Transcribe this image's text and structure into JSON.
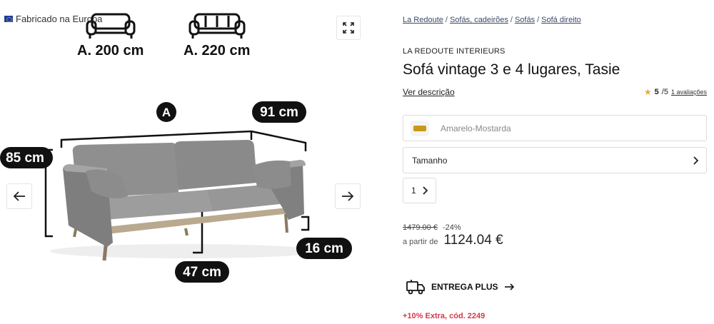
{
  "gallery": {
    "made_in": "Fabricado na Europa",
    "size_options": [
      {
        "label": "A. 200 cm"
      },
      {
        "label": "A. 220 cm"
      }
    ],
    "dimensions": {
      "marker": "A",
      "depth": "91 cm",
      "height": "85 cm",
      "seat_height": "47 cm",
      "leg_height": "16 cm"
    },
    "expand_icon": "expand-icon",
    "prev_icon": "arrow-left-icon",
    "next_icon": "arrow-right-icon"
  },
  "breadcrumb": [
    "La Redoute",
    "Sofás, cadeirões",
    "Sofás",
    "Sofá direito"
  ],
  "breadcrumb_separator": "/",
  "product": {
    "brand": "LA REDOUTE INTERIEURS",
    "title": "Sofá vintage 3 e 4 lugares, Tasie",
    "see_description": "Ver descrição",
    "rating": {
      "score": "5",
      "out_of": "/5",
      "reviews": "1 avaliações"
    },
    "color": {
      "label": "Amarelo-Mostarda",
      "swatch_color": "#c99818"
    },
    "size_label": "Tamanho",
    "quantity": "1",
    "old_price": "1479.00 €",
    "discount": "-24%",
    "price_prefix": "a partir de",
    "price": "1124.04 €",
    "delivery_label": "ENTREGA PLUS",
    "promo": "+10% Extra, cód. 2249"
  },
  "colors": {
    "star": "#f1a82c",
    "promo": "#d33a4a",
    "link": "#3b4a66"
  }
}
